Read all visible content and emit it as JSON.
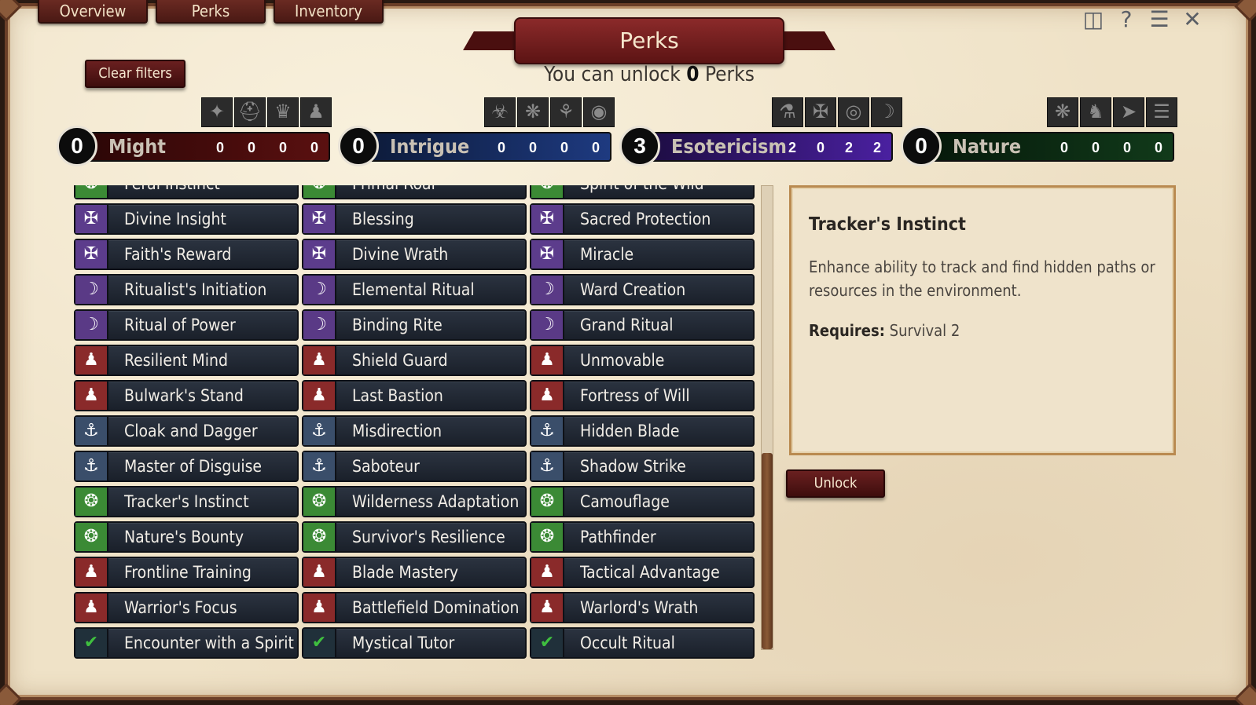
{
  "tabs": [
    "Overview",
    "Perks",
    "Inventory"
  ],
  "top_icons": [
    "map-icon",
    "help-icon",
    "menu-icon",
    "close-icon"
  ],
  "banner": {
    "title": "Perks",
    "unlock_prefix": "You can unlock",
    "unlock_count": "0",
    "unlock_suffix": "Perks"
  },
  "clear_filters": "Clear filters",
  "categories": [
    {
      "name": "Might",
      "level": "0",
      "counts": [
        "0",
        "0",
        "0",
        "0"
      ],
      "color": "#3a0b0b"
    },
    {
      "name": "Intrigue",
      "level": "0",
      "counts": [
        "0",
        "0",
        "0",
        "0"
      ],
      "color": "#102248"
    },
    {
      "name": "Esotericism",
      "level": "3",
      "counts": [
        "2",
        "0",
        "2",
        "2"
      ],
      "color": "#2a1458"
    },
    {
      "name": "Nature",
      "level": "0",
      "counts": [
        "0",
        "0",
        "0",
        "0"
      ],
      "color": "#0c2a12"
    }
  ],
  "perks": {
    "col1": [
      {
        "label": "Feral Instinct",
        "type": "nature"
      },
      {
        "label": "Divine Insight",
        "type": "divine"
      },
      {
        "label": "Faith's Reward",
        "type": "divine"
      },
      {
        "label": "Ritualist's Initiation",
        "type": "ritual"
      },
      {
        "label": "Ritual of Power",
        "type": "ritual"
      },
      {
        "label": "Resilient Mind",
        "type": "might"
      },
      {
        "label": "Bulwark's Stand",
        "type": "might"
      },
      {
        "label": "Cloak and Dagger",
        "type": "intrigue"
      },
      {
        "label": "Master of Disguise",
        "type": "intrigue"
      },
      {
        "label": "Tracker's Instinct",
        "type": "nature"
      },
      {
        "label": "Nature's Bounty",
        "type": "nature"
      },
      {
        "label": "Frontline Training",
        "type": "might"
      },
      {
        "label": "Warrior's Focus",
        "type": "might"
      },
      {
        "label": "Encounter with a Spirit",
        "type": "done"
      }
    ],
    "col2": [
      {
        "label": "Primal Roar",
        "type": "nature"
      },
      {
        "label": "Blessing",
        "type": "divine"
      },
      {
        "label": "Divine Wrath",
        "type": "divine"
      },
      {
        "label": "Elemental Ritual",
        "type": "ritual"
      },
      {
        "label": "Binding Rite",
        "type": "ritual"
      },
      {
        "label": "Shield Guard",
        "type": "might"
      },
      {
        "label": "Last Bastion",
        "type": "might"
      },
      {
        "label": "Misdirection",
        "type": "intrigue"
      },
      {
        "label": "Saboteur",
        "type": "intrigue"
      },
      {
        "label": "Wilderness Adaptation",
        "type": "nature"
      },
      {
        "label": "Survivor's Resilience",
        "type": "nature"
      },
      {
        "label": "Blade Mastery",
        "type": "might"
      },
      {
        "label": "Battlefield Domination",
        "type": "might"
      },
      {
        "label": "Mystical Tutor",
        "type": "done"
      }
    ],
    "col3": [
      {
        "label": "Spirit of the Wild",
        "type": "nature"
      },
      {
        "label": "Sacred Protection",
        "type": "divine"
      },
      {
        "label": "Miracle",
        "type": "divine"
      },
      {
        "label": "Ward Creation",
        "type": "ritual"
      },
      {
        "label": "Grand Ritual",
        "type": "ritual"
      },
      {
        "label": "Unmovable",
        "type": "might"
      },
      {
        "label": "Fortress of Will",
        "type": "might"
      },
      {
        "label": "Hidden Blade",
        "type": "intrigue"
      },
      {
        "label": "Shadow Strike",
        "type": "intrigue"
      },
      {
        "label": "Camouflage",
        "type": "nature"
      },
      {
        "label": "Pathfinder",
        "type": "nature"
      },
      {
        "label": "Tactical Advantage",
        "type": "might"
      },
      {
        "label": "Warlord's Wrath",
        "type": "might"
      },
      {
        "label": "Occult Ritual",
        "type": "done"
      }
    ]
  },
  "detail": {
    "title": "Tracker's Instinct",
    "description": "Enhance ability to track and find hidden paths or resources in the environment.",
    "requires_label": "Requires:",
    "requires_value": "Survival 2"
  },
  "unlock_button": "Unlock"
}
